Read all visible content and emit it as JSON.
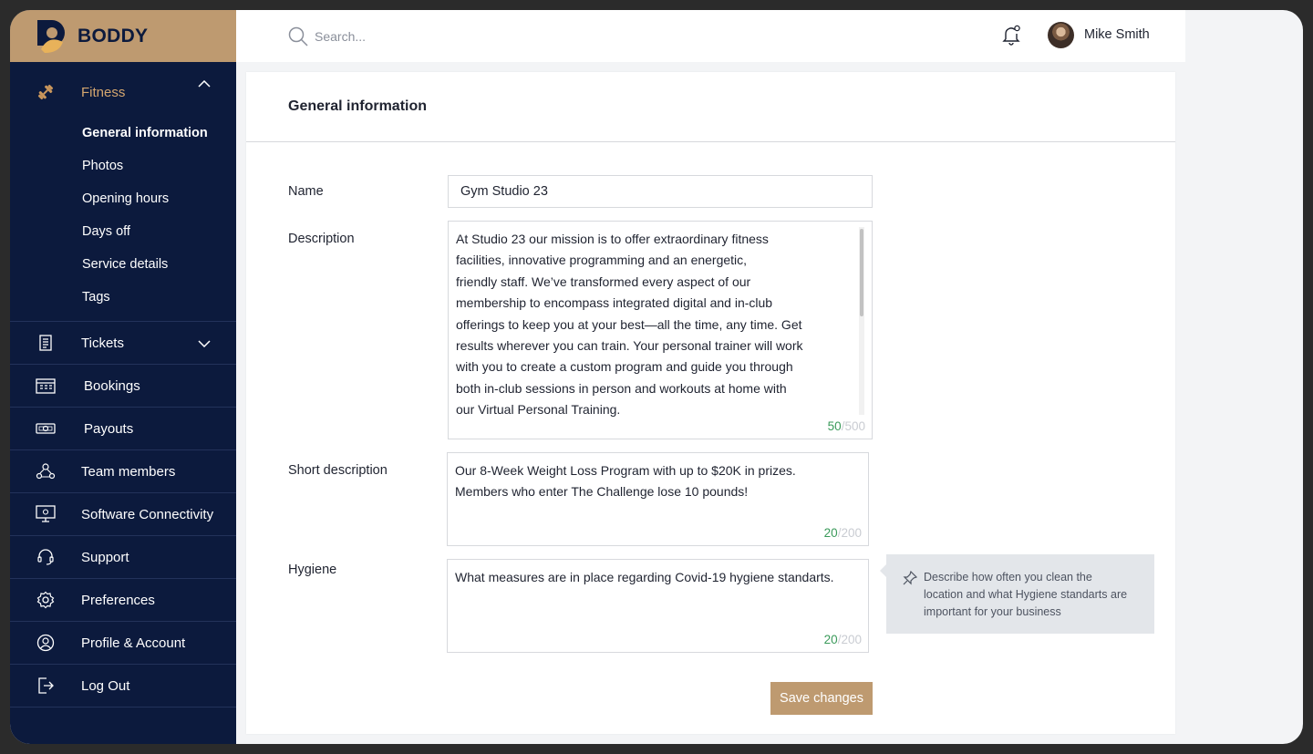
{
  "brand": {
    "name": "BODDY"
  },
  "colors": {
    "sidebar": "#0c1a3d",
    "accent": "#be9a70",
    "active_text": "#d4a66f",
    "counter_green": "#3a9a5a"
  },
  "sidebar": {
    "fitness": {
      "label": "Fitness",
      "icon": "dumbbell-icon",
      "subitems": [
        "General information",
        "Photos",
        "Opening hours",
        "Days off",
        "Service details",
        "Tags"
      ]
    },
    "items": [
      {
        "label": "Tickets",
        "icon": "receipt-icon"
      },
      {
        "label": "Bookings",
        "icon": "calendar-icon"
      },
      {
        "label": "Payouts",
        "icon": "money-icon"
      },
      {
        "label": "Team members",
        "icon": "team-icon"
      },
      {
        "label": "Software Connectivity",
        "icon": "monitor-icon"
      },
      {
        "label": "Support",
        "icon": "headset-icon"
      },
      {
        "label": "Preferences",
        "icon": "gear-icon"
      },
      {
        "label": "Profile & Account",
        "icon": "user-icon"
      },
      {
        "label": "Log Out",
        "icon": "logout-icon"
      }
    ]
  },
  "header": {
    "search_placeholder": "Search...",
    "user_name": "Mike Smith"
  },
  "form": {
    "title": "General information",
    "name_label": "Name",
    "name_value": "Gym Studio 23",
    "description_label": "Description",
    "description_value": "At Studio 23 our mission is to offer extraordinary fitness\nfacilities, innovative programming and an energetic,\nfriendly staff. We’ve transformed every aspect of our\nmembership to encompass integrated digital and in-club\nofferings to keep you at your best—all the time, any time. Get\nresults wherever you can train. Your personal trainer will work\nwith you to create a custom program and guide you through\nboth in-club sessions in person and workouts at home with\nour Virtual Personal Training.",
    "description_count": "50",
    "description_max": "500",
    "short_label": "Short description",
    "short_value": "Our 8-Week Weight Loss Program with up to $20K in prizes.\nMembers who enter The Challenge lose 10 pounds!",
    "short_count": "20",
    "short_max": "200",
    "hygiene_label": "Hygiene",
    "hygiene_value": "What measures are in place regarding Covid-19 hygiene standarts.",
    "hygiene_count": "20",
    "hygiene_max": "200",
    "tooltip": "Describe how often you clean the location and what Hygiene standarts are important for your business",
    "save_label": "Save changes"
  }
}
